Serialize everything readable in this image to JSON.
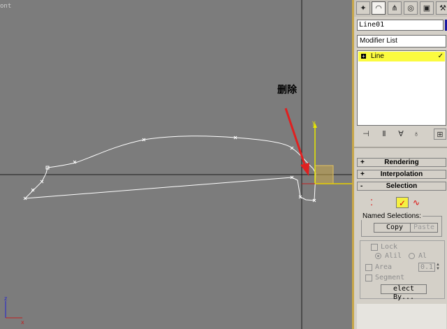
{
  "viewport": {
    "label": "ont",
    "annotation": "删除",
    "background": "#7c7c7c",
    "spline_color": "#ffffff",
    "gizmo_y_axis": "y",
    "arrow_color": "#e02020"
  },
  "command_panel": {
    "tabs": [
      "create-icon",
      "modify-icon",
      "hierarchy-icon",
      "motion-icon",
      "display-icon",
      "utilities-icon"
    ],
    "object_name": "Line01",
    "modifier_list": "Modifier List",
    "stack_item": "Line",
    "stack_expand": "+",
    "rollouts": {
      "rendering": {
        "sign": "+",
        "title": "Rendering"
      },
      "interpolation": {
        "sign": "+",
        "title": "Interpolation"
      },
      "selection": {
        "sign": "-",
        "title": "Selection"
      }
    },
    "selection": {
      "named_selections_title": "Named Selections:",
      "copy_label": "Copy",
      "paste_label": "Paste",
      "lock_label": "Lock",
      "all_label": "Alil",
      "al_label": "Al",
      "area_label": "Area",
      "area_value": "0.1",
      "segment_label": "Segment",
      "select_by_label": "elect By..."
    }
  }
}
